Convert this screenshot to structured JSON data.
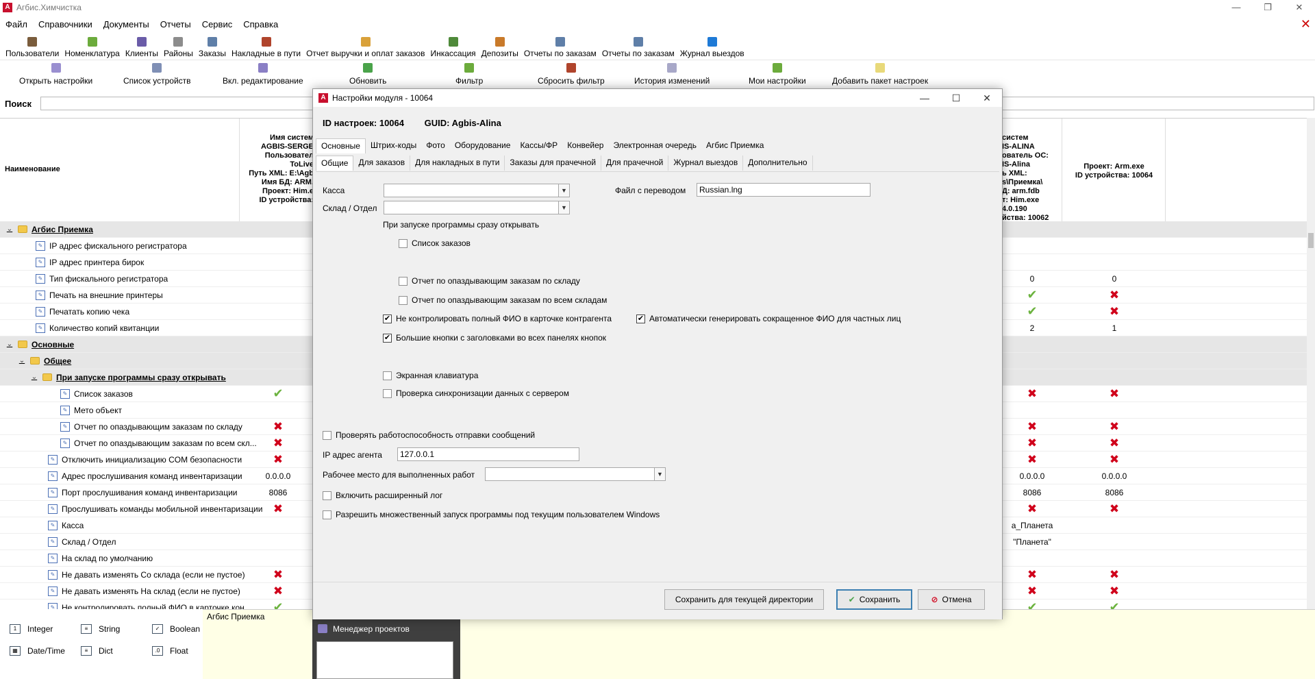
{
  "window": {
    "title": "Агбис.Химчистка"
  },
  "menu": [
    "Файл",
    "Справочники",
    "Документы",
    "Отчеты",
    "Сервис",
    "Справка"
  ],
  "toolbar1": [
    {
      "label": "Пользователи",
      "icon": "users-icon",
      "color": "#7a5c3c"
    },
    {
      "label": "Номенклатура",
      "icon": "nomenclature-icon",
      "color": "#6cab3c"
    },
    {
      "label": "Клиенты",
      "icon": "clients-icon",
      "color": "#6a5ca8"
    },
    {
      "label": "Районы",
      "icon": "districts-icon",
      "color": "#8c8c8c"
    },
    {
      "label": "Заказы",
      "icon": "orders-icon",
      "color": "#5f7fa8"
    },
    {
      "label": "Накладные в пути",
      "icon": "waybills-icon",
      "color": "#b0442c"
    },
    {
      "label": "Отчет выручки и оплат заказов",
      "icon": "revenue-report-icon",
      "color": "#d9a13a"
    },
    {
      "label": "Инкассация",
      "icon": "collection-icon",
      "color": "#4f8a3a"
    },
    {
      "label": "Депозиты",
      "icon": "deposits-icon",
      "color": "#c97a2a"
    },
    {
      "label": "Отчеты по заказам",
      "icon": "orders-report-icon",
      "color": "#5f7fa8"
    },
    {
      "label": "Отчеты по заказам",
      "icon": "orders-report-icon",
      "color": "#5f7fa8"
    },
    {
      "label": "Журнал выездов",
      "icon": "trips-journal-icon",
      "color": "#1e7ad6"
    }
  ],
  "toolbar2": [
    "Открыть настройки",
    "Список устройств",
    "Вкл. редактирование",
    "Обновить",
    "Фильтр",
    "Сбросить фильтр",
    "История изменений",
    "Мои настройки",
    "Добавить пакет настроек"
  ],
  "search": {
    "label": "Поиск",
    "value": ""
  },
  "grid": {
    "name_header": "Наименование",
    "col1_header": "Имя систем\nAGBIS-SERGE\nПользовател\nToLive\nПуть XML: E:\\Agb\nИмя БД: ARM.\nПроект: Him.e\nID устройства: ",
    "col_right_a_header": "систем\nIS-ALINA\nователь ОС:\nIS-Alina\nь XML:\ns\\Приемка\\\nД: arm.fdb\nт: Him.exe\n4.0.190\nйства: 10062",
    "col_right_b_header": "Проект: Arm.exe\nID устройства: 10064",
    "rows": [
      {
        "label": "Агбис Приемка",
        "level": 0,
        "group": true,
        "c1": "",
        "ca": "",
        "cb": ""
      },
      {
        "label": "IP адрес фискального регистратора",
        "level": 1,
        "group": false,
        "c1": "",
        "ca": "",
        "cb": ""
      },
      {
        "label": "IP адрес принтера бирок",
        "level": 1,
        "group": false,
        "c1": "",
        "ca": "",
        "cb": ""
      },
      {
        "label": "Тип фискального регистратора",
        "level": 1,
        "group": false,
        "c1": "",
        "ca": "0",
        "cb": "0"
      },
      {
        "label": "Печать на внешние принтеры",
        "level": 1,
        "group": false,
        "c1": "",
        "ca": "check",
        "cb": "cross"
      },
      {
        "label": "Печатать копию чека",
        "level": 1,
        "group": false,
        "c1": "",
        "ca": "check",
        "cb": "cross"
      },
      {
        "label": "Количество копий квитанции",
        "level": 1,
        "group": false,
        "c1": "",
        "ca": "2",
        "cb": "1"
      },
      {
        "label": "Основные",
        "level": 0,
        "group": true,
        "c1": "",
        "ca": "",
        "cb": ""
      },
      {
        "label": "Общее",
        "level": 1,
        "group": true,
        "c1": "",
        "ca": "",
        "cb": ""
      },
      {
        "label": "При запуске программы сразу открывать",
        "level": 2,
        "group": true,
        "c1": "",
        "ca": "",
        "cb": ""
      },
      {
        "label": "Список заказов",
        "level": 3,
        "group": false,
        "c1": "check",
        "ca": "cross",
        "cb": "cross"
      },
      {
        "label": "Мето объект",
        "level": 3,
        "group": false,
        "c1": "",
        "ca": "",
        "cb": ""
      },
      {
        "label": "Отчет по опаздывающим заказам по складу",
        "level": 3,
        "group": false,
        "c1": "cross",
        "ca": "cross",
        "cb": "cross"
      },
      {
        "label": "Отчет по опаздывающим заказам по всем скл...",
        "level": 3,
        "group": false,
        "c1": "cross",
        "ca": "cross",
        "cb": "cross"
      },
      {
        "label": "Отключить инициализацию COM безопасности",
        "level": 2,
        "group": false,
        "c1": "cross",
        "ca": "cross",
        "cb": "cross"
      },
      {
        "label": "Адрес прослушивания команд инвентаризации",
        "level": 2,
        "group": false,
        "c1": "0.0.0.0",
        "ca": "0.0.0.0",
        "cb": "0.0.0.0"
      },
      {
        "label": "Порт прослушивания команд инвентаризации",
        "level": 2,
        "group": false,
        "c1": "8086",
        "ca": "8086",
        "cb": "8086"
      },
      {
        "label": "Прослушивать команды мобильной инвентаризации",
        "level": 2,
        "group": false,
        "c1": "cross",
        "ca": "cross",
        "cb": "cross"
      },
      {
        "label": "Касса",
        "level": 2,
        "group": false,
        "c1": "",
        "ca": "а_Планета",
        "cb": ""
      },
      {
        "label": "Склад / Отдел",
        "level": 2,
        "group": false,
        "c1": "",
        "ca": "\"Планета\"",
        "cb": ""
      },
      {
        "label": "На склад по умолчанию",
        "level": 2,
        "group": false,
        "c1": "",
        "ca": "",
        "cb": ""
      },
      {
        "label": "Не давать изменять Со склада (если не пустое)",
        "level": 2,
        "group": false,
        "c1": "cross",
        "ca": "cross",
        "cb": "cross"
      },
      {
        "label": "Не давать изменять На склад (если не пустое)",
        "level": 2,
        "group": false,
        "c1": "cross",
        "ca": "cross",
        "cb": "cross"
      },
      {
        "label": "Не контролировать полный ФИО в карточке кон...",
        "level": 2,
        "group": false,
        "c1": "check",
        "ca": "check",
        "cb": "check"
      }
    ]
  },
  "types": [
    {
      "label": "Integer",
      "icon": "integer-type-icon",
      "glyph": "1"
    },
    {
      "label": "String",
      "icon": "string-type-icon",
      "glyph": "≡"
    },
    {
      "label": "Boolean",
      "icon": "boolean-type-icon",
      "glyph": "✓"
    },
    {
      "label": "Date/Time",
      "icon": "datetime-type-icon",
      "glyph": "▦"
    },
    {
      "label": "Dict",
      "icon": "dict-type-icon",
      "glyph": "≡"
    },
    {
      "label": "Float",
      "icon": "float-type-icon",
      "glyph": ".0"
    }
  ],
  "description_panel": "Агбис Приемка",
  "taskbar_thumb": {
    "title": "Менеджер проектов"
  },
  "dialog": {
    "title": "Настройки модуля  - 10064",
    "id_label": "ID настроек: 10064",
    "guid_label": "GUID: Agbis-Alina",
    "tabs_main": [
      "Основные",
      "Штрих-коды",
      "Фото",
      "Оборудование",
      "Кассы/ФР",
      "Конвейер",
      "Электронная очередь",
      "Агбис Приемка"
    ],
    "tabs_sub": [
      "Общие",
      "Для заказов",
      "Для накладных в пути",
      "Заказы для прачечной",
      "Для прачечной",
      "Журнал выездов",
      "Дополнительно"
    ],
    "kassa_label": "Касса",
    "sklad_label": "Склад / Отдел",
    "lang_label": "Файл с переводом",
    "lang_value": "Russian.lng",
    "startup_label": "При запуске программы сразу открывать",
    "cb_orders": "Список заказов",
    "cb_late_store": "Отчет по опаздывающим заказам по складу",
    "cb_late_all": "Отчет по опаздывающим заказам по всем складам",
    "cb_fio": "Не контролировать полный ФИО в карточке контрагента",
    "cb_autofio": "Автоматически генерировать сокращенное ФИО для частных лиц",
    "cb_bigbtn": "Большие кнопки с заголовками во всех панелях кнопок",
    "cb_keyboard": "Экранная клавиатура",
    "cb_sync": "Проверка синхронизации данных с сервером",
    "cb_msgcheck": "Проверять работоспособность отправки сообщений",
    "agent_label": "IP адрес агента",
    "agent_value": "127.0.0.1",
    "workplace_label": "Рабочее место для выполненных работ",
    "cb_extlog": "Включить расширенный лог",
    "cb_multirun": "Разрешить множественный запуск программы под текущим пользователем Windows",
    "btn_save_dir": "Сохранить для текущей директории",
    "btn_save": "Сохранить",
    "btn_cancel": "Отмена"
  }
}
